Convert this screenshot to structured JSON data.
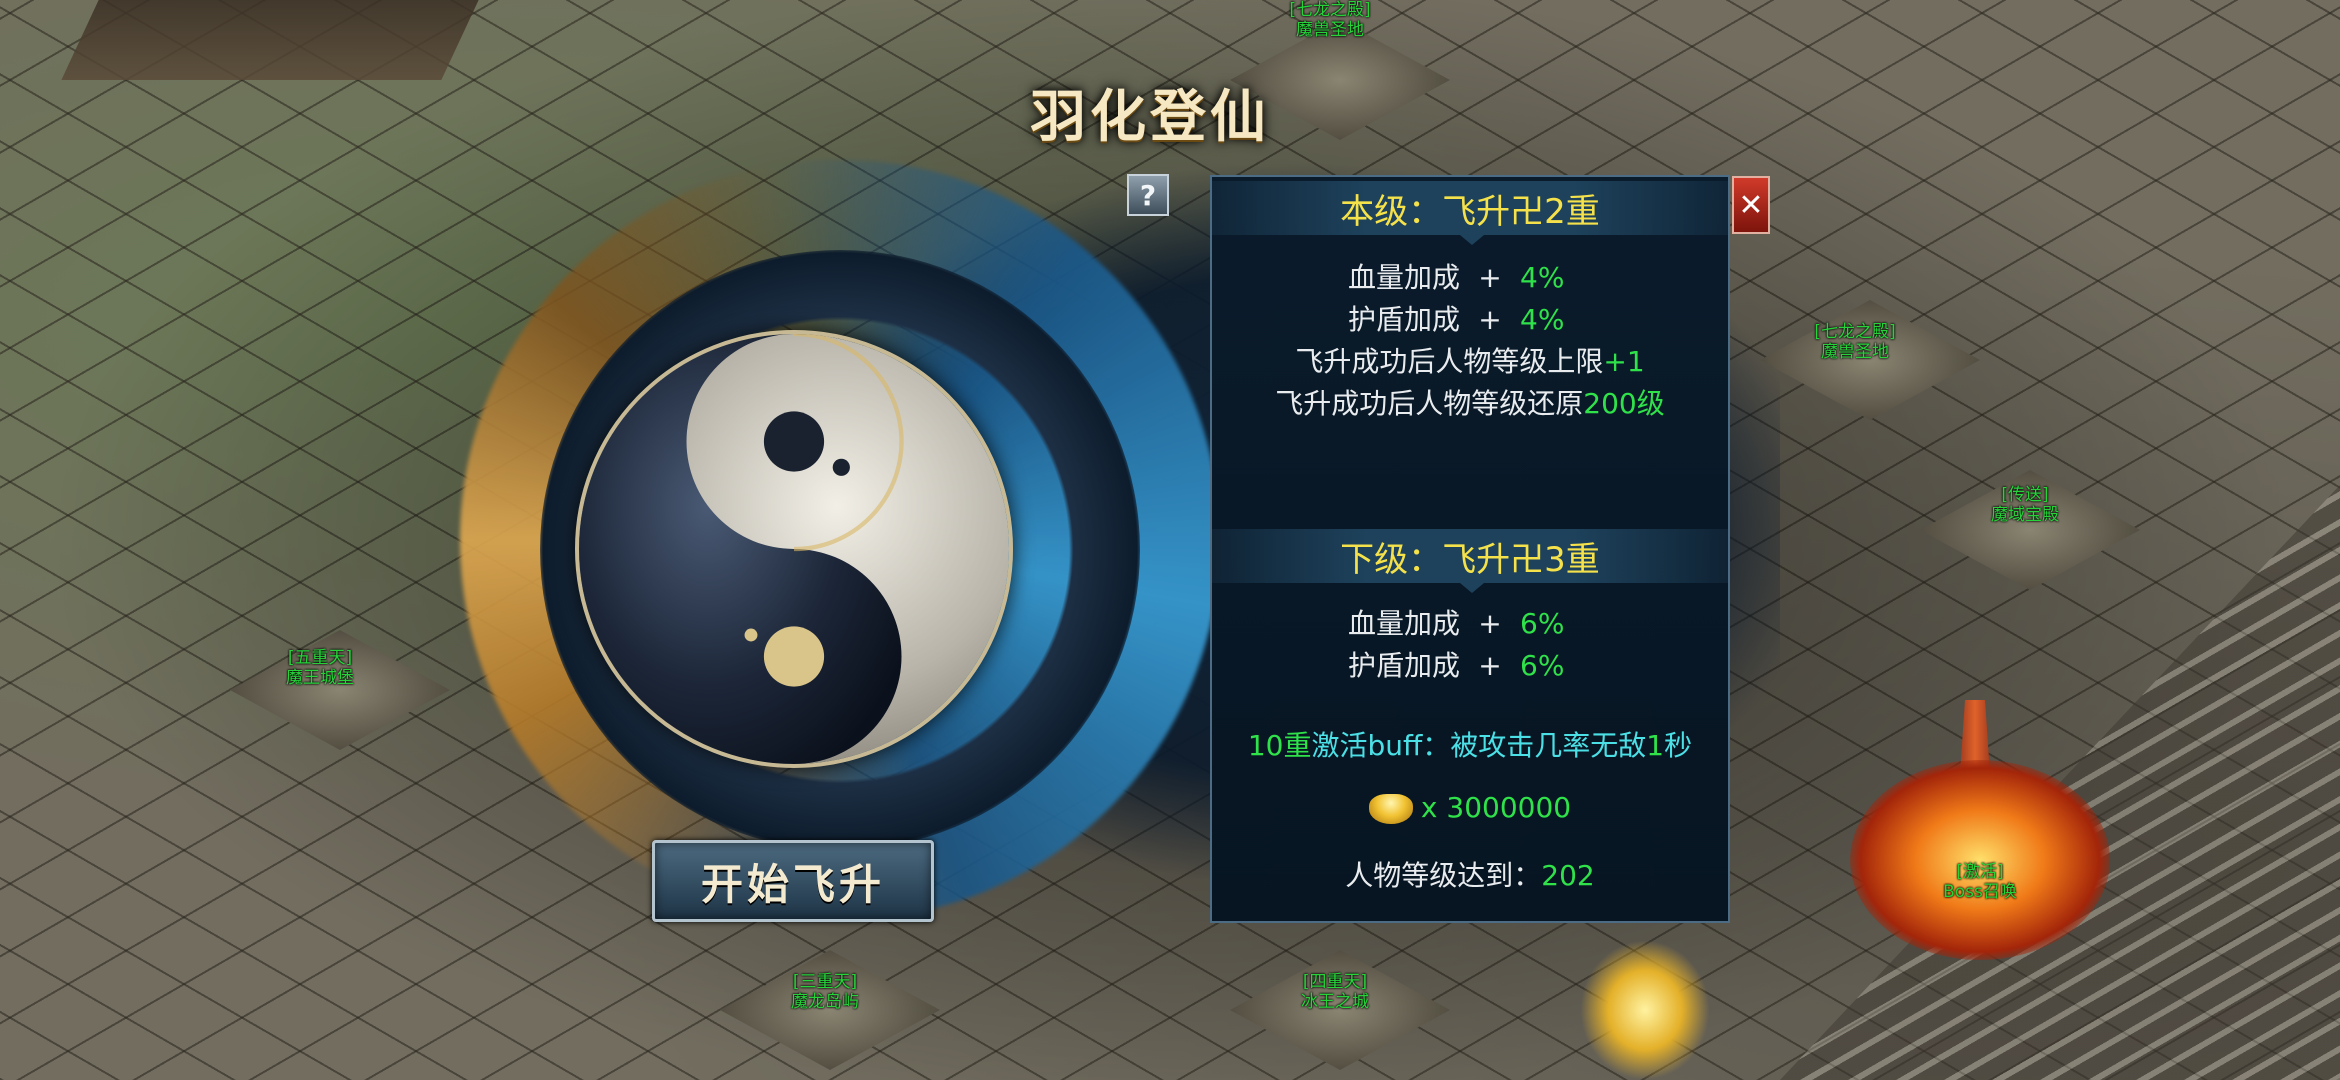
{
  "dialog": {
    "title": "羽化登仙",
    "help_label": "?",
    "close_label": "✕",
    "start_button": "开始飞升"
  },
  "current_level": {
    "label": "本级：",
    "name": "飞升卍2重",
    "stats": [
      {
        "label": "血量加成",
        "plus": "+",
        "value": "4%"
      },
      {
        "label": "护盾加成",
        "plus": "+",
        "value": "4%"
      }
    ],
    "note1_text": "飞升成功后人物等级上限",
    "note1_value": "+1",
    "note2_text": "飞升成功后人物等级还原",
    "note2_value": "200级"
  },
  "next_level": {
    "label": "下级：",
    "name": "飞升卍3重",
    "stats": [
      {
        "label": "血量加成",
        "plus": "+",
        "value": "6%"
      },
      {
        "label": "护盾加成",
        "plus": "+",
        "value": "6%"
      }
    ],
    "buff_prefix": "10重",
    "buff_text": "激活buff：被攻击几率无敌",
    "buff_value": "1",
    "buff_unit": "秒"
  },
  "cost": {
    "icon": "gold-ingot-icon",
    "amount": "x 3000000"
  },
  "requirement": {
    "label": "人物等级达到：",
    "value": "202"
  },
  "map_labels": [
    {
      "line1": "[七龙之殿]",
      "line2": "魔兽圣地"
    },
    {
      "line1": "[七龙之殿]",
      "line2": "魔兽圣地"
    },
    {
      "line1": "[传送]",
      "line2": "魔域宝殿"
    },
    {
      "line1": "[五重天]",
      "line2": "魔王城堡"
    },
    {
      "line1": "[三重天]",
      "line2": "魔龙岛屿"
    },
    {
      "line1": "[四重天]",
      "line2": "冰王之城"
    },
    {
      "line1": "[激活]",
      "line2": "Boss召唤"
    }
  ],
  "colors": {
    "accent_yellow": "#f5e24a",
    "value_green": "#2fe24a",
    "buff_cyan": "#4be0e6"
  }
}
